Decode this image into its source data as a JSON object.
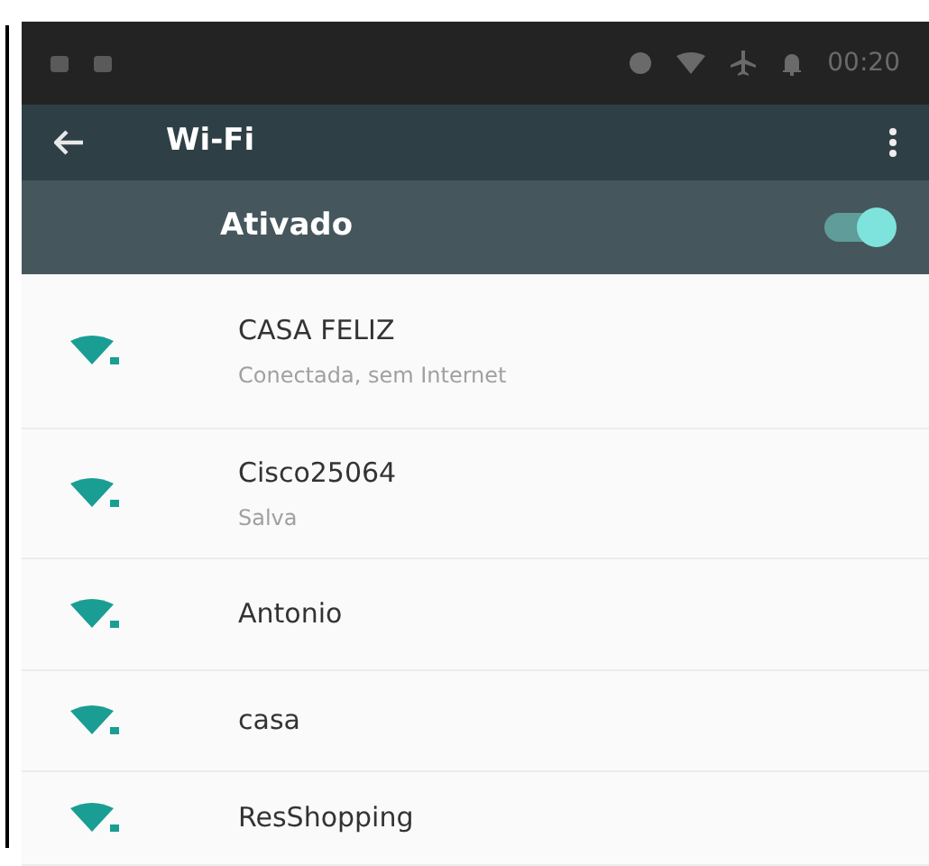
{
  "status_bar": {
    "time": "00:20"
  },
  "toolbar": {
    "title": "Wi-Fi"
  },
  "master_switch": {
    "label": "Ativado",
    "on": true
  },
  "networks": [
    {
      "name": "CASA FELIZ",
      "status": "Conectada, sem Internet"
    },
    {
      "name": "Cisco25064",
      "status": "Salva"
    },
    {
      "name": "Antonio"
    },
    {
      "name": "casa"
    },
    {
      "name": "ResShopping"
    }
  ]
}
